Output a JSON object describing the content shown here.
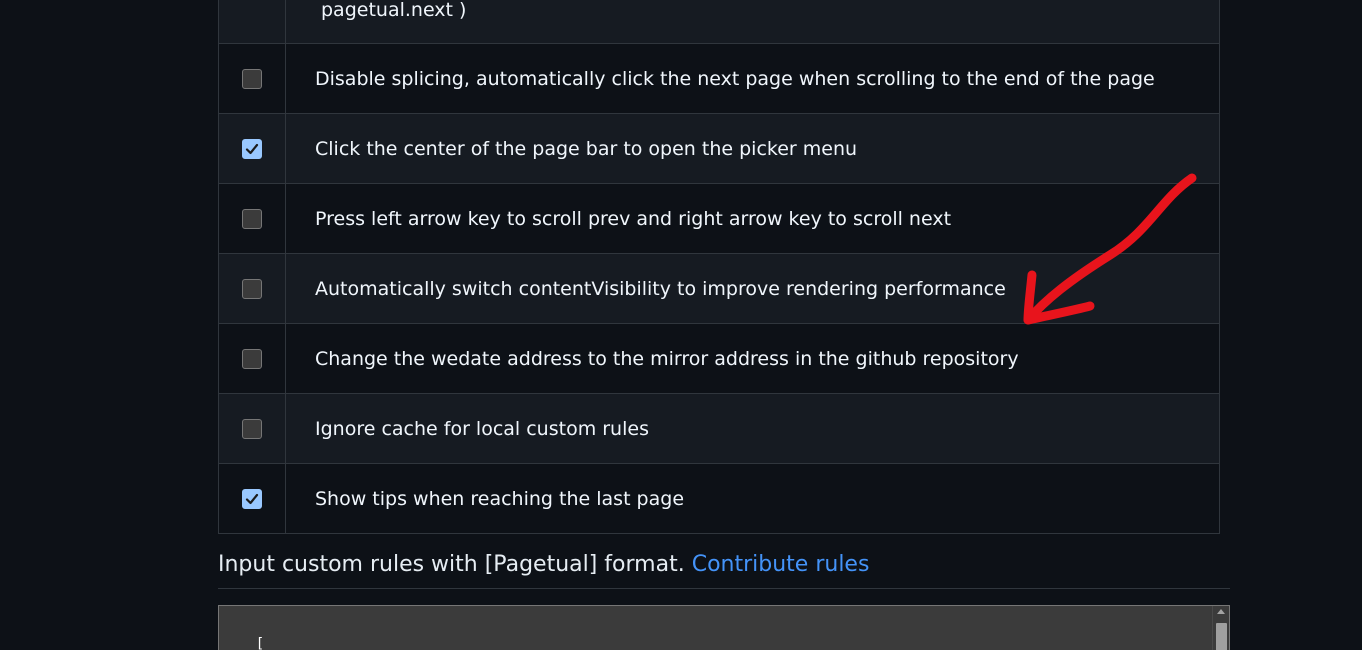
{
  "options": [
    {
      "label": "pagetual.next )",
      "checked": false,
      "partial": true
    },
    {
      "label": "Disable splicing, automatically click the next page when scrolling to the end of the page",
      "checked": false
    },
    {
      "label": "Click the center of the page bar to open the picker menu",
      "checked": true
    },
    {
      "label": "Press left arrow key to scroll prev and right arrow key to scroll next",
      "checked": false
    },
    {
      "label": "Automatically switch contentVisibility to improve rendering performance",
      "checked": false
    },
    {
      "label": "Change the wedate address to the mirror address in the github repository",
      "checked": false
    },
    {
      "label": "Ignore cache for local custom rules",
      "checked": false
    },
    {
      "label": "Show tips when reaching the last page",
      "checked": true
    }
  ],
  "custom_rules": {
    "heading": "Input custom rules with [Pagetual] format.",
    "link_label": "Contribute rules",
    "editor_value": "[\n  {"
  },
  "colors": {
    "link": "#4493f8",
    "annotation": "#e8141c",
    "checkbox_checked": "#99c8ff"
  }
}
